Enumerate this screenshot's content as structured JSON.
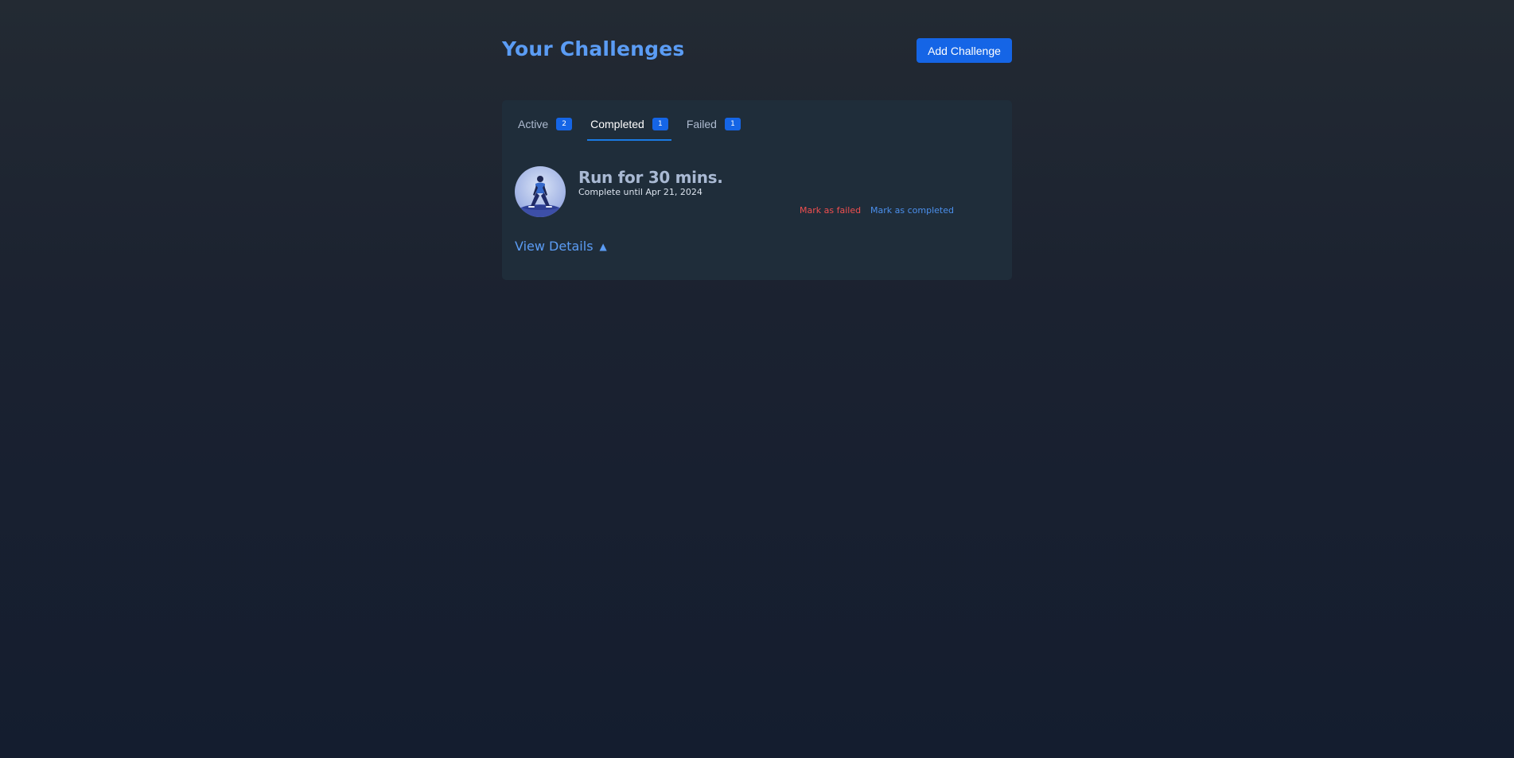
{
  "header": {
    "title": "Your Challenges",
    "add_button_label": "Add Challenge"
  },
  "tabs": [
    {
      "label": "Active",
      "count": "2",
      "active": false
    },
    {
      "label": "Completed",
      "count": "1",
      "active": true
    },
    {
      "label": "Failed",
      "count": "1",
      "active": false
    }
  ],
  "challenge": {
    "avatar_icon": "runner-stretch-icon",
    "title": "Run for 30 mins.",
    "subtitle": "Complete until Apr 21, 2024",
    "mark_failed_label": "Mark as failed",
    "mark_completed_label": "Mark as completed"
  },
  "details": {
    "label": "View Details",
    "arrow": "▲"
  },
  "colors": {
    "accent": "#1565e6",
    "title": "#5b9cf4",
    "danger": "#f04f4f",
    "panel": "#1f2d3a"
  }
}
